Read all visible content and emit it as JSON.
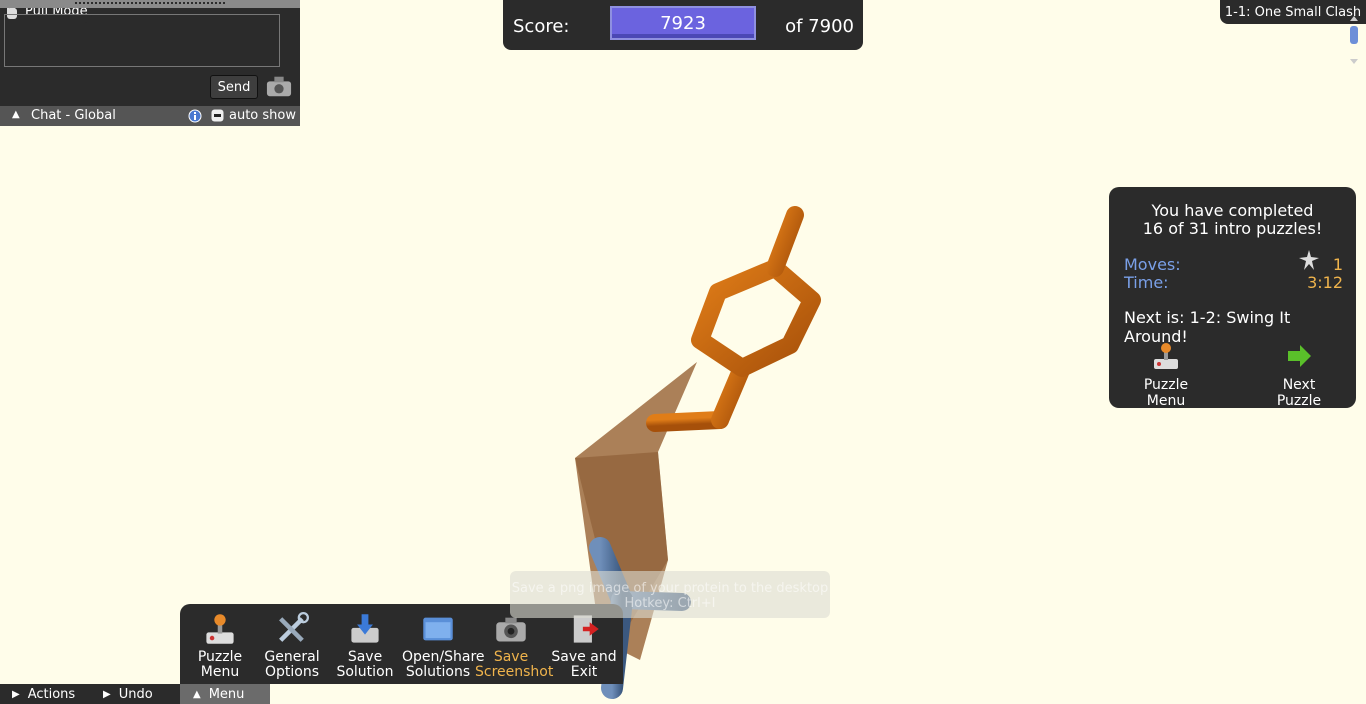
{
  "pull_mode": {
    "label": "Pull Mode"
  },
  "score": {
    "label": "Score:",
    "value": "7923",
    "max": "of 7900"
  },
  "puzzle": {
    "name": "1-1: One Small Clash"
  },
  "completion": {
    "message_line1": "You have completed",
    "message_line2": "16 of 31 intro puzzles!",
    "moves_label": "Moves:",
    "moves_value": "1",
    "time_label": "Time:",
    "time_value": "3:12",
    "next_is": "Next is: 1-2: Swing It Around!",
    "puzzle_menu_label": "Puzzle Menu",
    "next_puzzle_label": "Next Puzzle"
  },
  "menu": {
    "items": [
      {
        "line1": "Puzzle",
        "line2": "Menu"
      },
      {
        "line1": "General",
        "line2": "Options"
      },
      {
        "line1": "Save",
        "line2": "Solution"
      },
      {
        "line1": "Open/Share",
        "line2": "Solutions"
      },
      {
        "line1": "Save",
        "line2": "Screenshot"
      },
      {
        "line1": "Save and",
        "line2": "Exit"
      }
    ]
  },
  "tooltip": {
    "line1": "Save a png image of your protein to the desktop",
    "line2": "Hotkey: Ctrl+I"
  },
  "bottom_bar": {
    "actions": "Actions",
    "undo": "Undo",
    "menu": "Menu"
  },
  "chat": {
    "send": "Send",
    "channel": "Chat - Global",
    "auto_show": "auto show"
  },
  "colors": {
    "background": "#fffdea",
    "panel": "#2b2b2b",
    "score_box": "#6b63df",
    "accent_orange": "#f0b44c",
    "label_blue": "#7aa0e8",
    "sidechain_orange": "#c0620c",
    "backbone_blue": "#4f6f9a",
    "sheet_brown": "#9c6a3e"
  }
}
